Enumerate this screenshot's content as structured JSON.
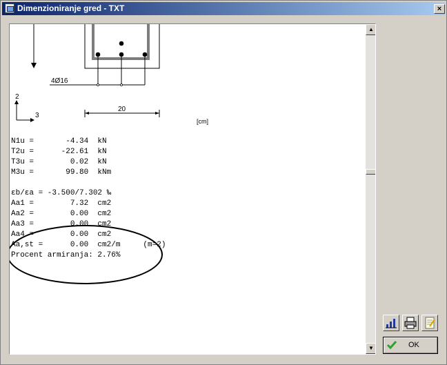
{
  "window": {
    "title": "Dimenzioniranje gred - TXT",
    "close_label": "×"
  },
  "drawing": {
    "rebar_label": "4Ø16",
    "axis_2": "2",
    "axis_3": "3",
    "dimension_value": "20",
    "unit_label": "[cm]"
  },
  "results": {
    "forces": [
      "N1u =       -4.34  kN",
      "T2u =      -22.61  kN",
      "T3u =        0.02  kN",
      "M3u =       99.80  kNm"
    ],
    "strain": "εb/εa = -3.500/7.302 ‰",
    "reinforcement": [
      "Aa1 =        7.32  cm2",
      "Aa2 =        0.00  cm2",
      "Aa3 =        0.00  cm2",
      "Aa4 =        0.00  cm2",
      "Aa,st =      0.00  cm2/m     (m=2)"
    ],
    "percent": "Procent armiranja: 2.76%"
  },
  "buttons": {
    "ok_label": "OK"
  },
  "icons": {
    "toolbar": [
      "chart-icon",
      "printer-icon",
      "notepad-icon"
    ],
    "ok": "checkmark-icon"
  }
}
